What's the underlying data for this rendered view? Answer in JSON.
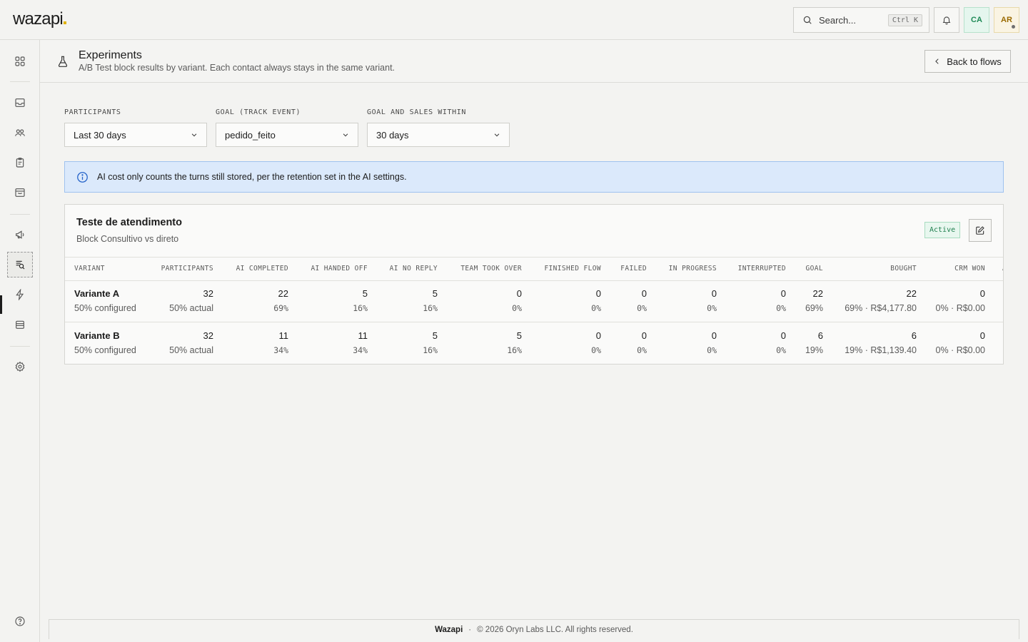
{
  "app": {
    "logo": "wazapi"
  },
  "topbar": {
    "search_placeholder": "Search...",
    "search_shortcut": "Ctrl K",
    "avatar_ca": "CA",
    "avatar_ar": "AR"
  },
  "sidebar": {
    "items": [
      {
        "name": "dashboard",
        "icon": "grid-icon"
      },
      {
        "name": "inbox",
        "icon": "inbox-icon"
      },
      {
        "name": "contacts",
        "icon": "users-icon"
      },
      {
        "name": "tasks",
        "icon": "clipboard-icon"
      },
      {
        "name": "store",
        "icon": "store-icon"
      },
      {
        "name": "campaigns",
        "icon": "megaphone-icon"
      },
      {
        "name": "experiments",
        "icon": "experiments-icon",
        "active": true
      },
      {
        "name": "automations",
        "icon": "lightning-icon"
      },
      {
        "name": "archive",
        "icon": "archive-icon"
      },
      {
        "name": "settings",
        "icon": "gear-icon"
      },
      {
        "name": "help",
        "icon": "help-icon"
      }
    ]
  },
  "page": {
    "title": "Experiments",
    "subtitle": "A/B Test block results by variant. Each contact always stays in the same variant.",
    "back_label": "Back to flows"
  },
  "filters": {
    "participants": {
      "label": "PARTICIPANTS",
      "value": "Last 30 days"
    },
    "goal": {
      "label": "GOAL (TRACK EVENT)",
      "value": "pedido_feito"
    },
    "window": {
      "label": "GOAL AND SALES WITHIN",
      "value": "30 days"
    }
  },
  "alert": {
    "text": "AI cost only counts the turns still stored, per the retention set in the AI settings."
  },
  "experiment": {
    "title": "Teste de atendimento",
    "subtitle": "Block Consultivo vs direto",
    "status": "Active",
    "columns": [
      "VARIANT",
      "PARTICIPANTS",
      "AI COMPLETED",
      "AI HANDED OFF",
      "AI NO REPLY",
      "TEAM TOOK OVER",
      "FINISHED FLOW",
      "FAILED",
      "IN PROGRESS",
      "INTERRUPTED",
      "GOAL",
      "BOUGHT",
      "CRM WON",
      "A"
    ],
    "rows": [
      {
        "variant": "Variante A",
        "variant_sub": "50% configured",
        "participants": "32",
        "participants_sub": "50% actual",
        "ai_completed": "22",
        "ai_completed_sub": "69%",
        "ai_handed_off": "5",
        "ai_handed_off_sub": "16%",
        "ai_no_reply": "5",
        "ai_no_reply_sub": "16%",
        "team_took_over": "0",
        "team_took_over_sub": "0%",
        "finished_flow": "0",
        "finished_flow_sub": "0%",
        "failed": "0",
        "failed_sub": "0%",
        "in_progress": "0",
        "in_progress_sub": "0%",
        "interrupted": "0",
        "interrupted_sub": "0%",
        "goal": "22",
        "goal_sub": "69%",
        "bought": "22",
        "bought_sub": "69% · R$4,177.80",
        "crm_won": "0",
        "crm_won_sub": "0% · R$0.00"
      },
      {
        "variant": "Variante B",
        "variant_sub": "50% configured",
        "participants": "32",
        "participants_sub": "50% actual",
        "ai_completed": "11",
        "ai_completed_sub": "34%",
        "ai_handed_off": "11",
        "ai_handed_off_sub": "34%",
        "ai_no_reply": "5",
        "ai_no_reply_sub": "16%",
        "team_took_over": "5",
        "team_took_over_sub": "16%",
        "finished_flow": "0",
        "finished_flow_sub": "0%",
        "failed": "0",
        "failed_sub": "0%",
        "in_progress": "0",
        "in_progress_sub": "0%",
        "interrupted": "0",
        "interrupted_sub": "0%",
        "goal": "6",
        "goal_sub": "19%",
        "bought": "6",
        "bought_sub": "19% · R$1,139.40",
        "crm_won": "0",
        "crm_won_sub": "0% · R$0.00"
      }
    ]
  },
  "footer": {
    "brand": "Wazapi",
    "copyright": "© 2026 Oryn Labs LLC. All rights reserved."
  }
}
